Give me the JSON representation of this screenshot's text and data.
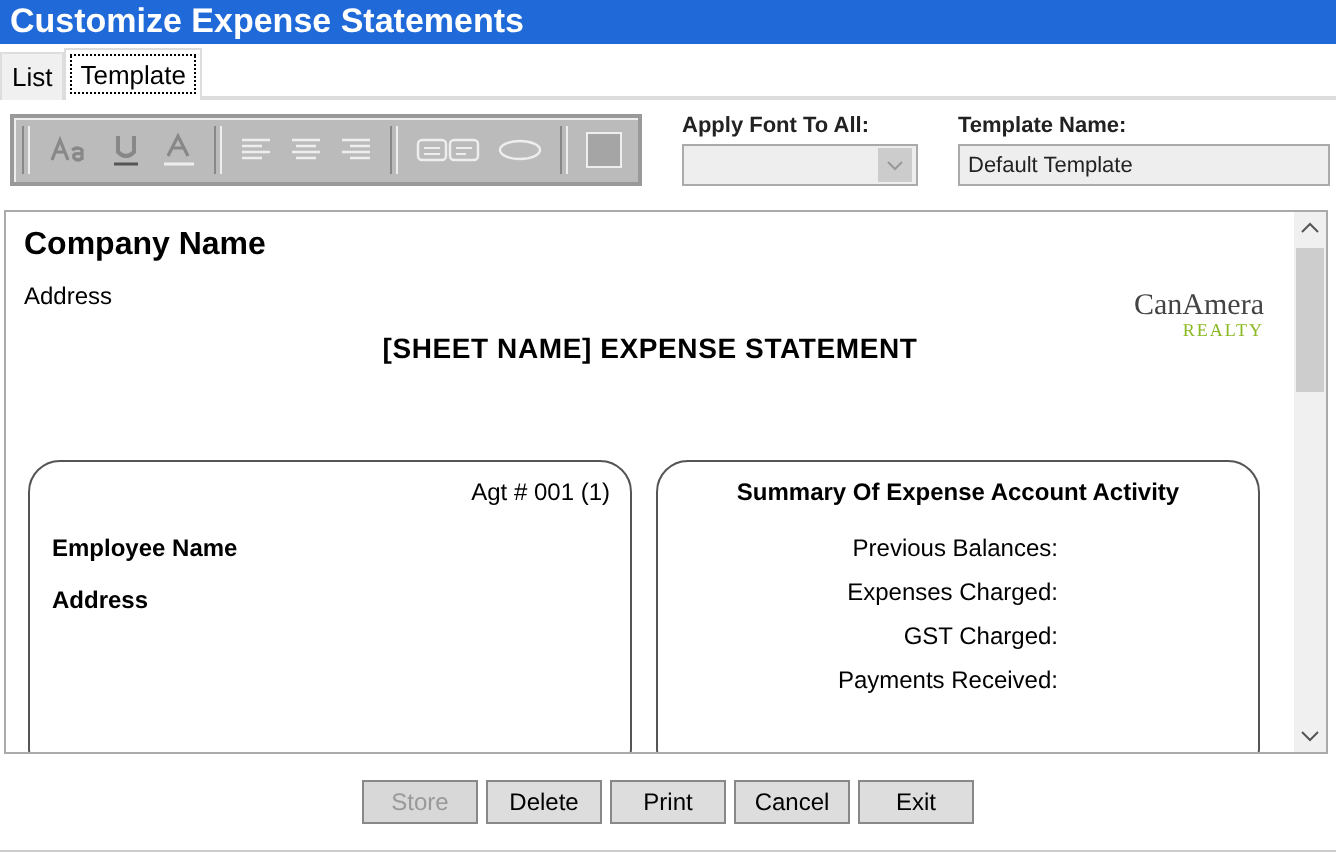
{
  "window": {
    "title": "Customize Expense Statements"
  },
  "tabs": [
    {
      "label": "List",
      "selected": false
    },
    {
      "label": "Template",
      "selected": true
    }
  ],
  "apply_font": {
    "label": "Apply Font To All:",
    "disabled": true
  },
  "template_name": {
    "label": "Template Name:",
    "value": "Default Template"
  },
  "document": {
    "company_name": "Company Name",
    "address": "Address",
    "logo": {
      "name": "CanAmera",
      "tagline": "REALTY"
    },
    "heading": "[SHEET NAME] EXPENSE STATEMENT",
    "agent_box": {
      "agent": "Agt # 001 (1)",
      "employee_name": "Employee Name",
      "address": "Address"
    },
    "summary_box": {
      "title": "Summary Of Expense Account Activity",
      "rows": [
        "Previous Balances:",
        "Expenses Charged:",
        "GST Charged:",
        "Payments Received:"
      ]
    }
  },
  "buttons": [
    {
      "label": "Store",
      "disabled": true
    },
    {
      "label": "Delete",
      "disabled": false
    },
    {
      "label": "Print",
      "disabled": false
    },
    {
      "label": "Cancel",
      "disabled": false
    },
    {
      "label": "Exit",
      "disabled": false
    }
  ]
}
